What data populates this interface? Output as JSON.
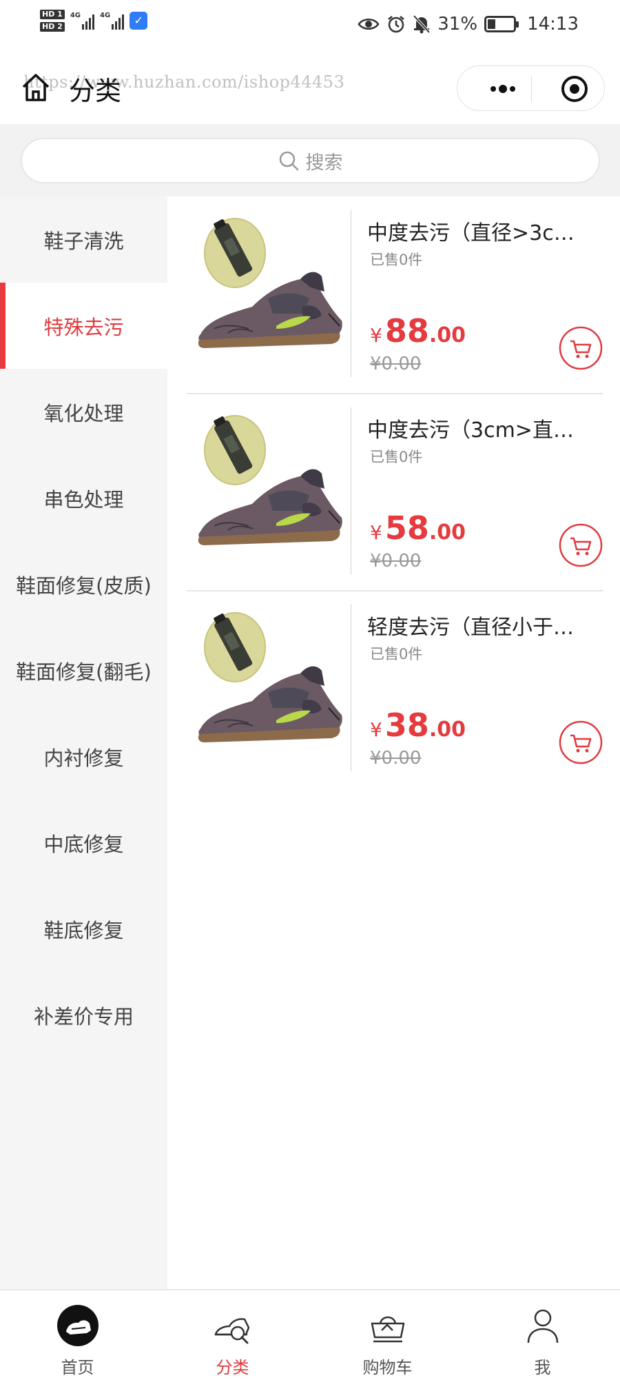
{
  "status_bar": {
    "hd1": "HD 1",
    "hd2": "HD 2",
    "net1": "4G",
    "net2": "4G",
    "battery_percent": "31%",
    "battery_level": 0.31,
    "time": "14:13",
    "icons": [
      "eye-icon",
      "alarm-icon",
      "mute-bell-icon",
      "battery-icon"
    ]
  },
  "nav": {
    "title": "分类",
    "watermark": "https://www.huzhan.com/ishop44453"
  },
  "search": {
    "placeholder": "搜索"
  },
  "sidebar": {
    "items": [
      {
        "label": "鞋子清洗"
      },
      {
        "label": "特殊去污"
      },
      {
        "label": "氧化处理"
      },
      {
        "label": "串色处理"
      },
      {
        "label": "鞋面修复(皮质)"
      },
      {
        "label": "鞋面修复(翻毛)"
      },
      {
        "label": "内衬修复"
      },
      {
        "label": "中底修复"
      },
      {
        "label": "鞋底修复"
      },
      {
        "label": "补差价专用"
      }
    ],
    "active_index": 1
  },
  "products": [
    {
      "name": "中度去污（直径>3c…",
      "sold": "已售0件",
      "currency": "¥",
      "price_int": "88",
      "price_dec": ".00",
      "original": "¥0.00"
    },
    {
      "name": "中度去污（3cm>直…",
      "sold": "已售0件",
      "currency": "¥",
      "price_int": "58",
      "price_dec": ".00",
      "original": "¥0.00"
    },
    {
      "name": "轻度去污（直径小于…",
      "sold": "已售0件",
      "currency": "¥",
      "price_int": "38",
      "price_dec": ".00",
      "original": "¥0.00"
    }
  ],
  "tabbar": {
    "items": [
      {
        "label": "首页",
        "icon": "home-icon"
      },
      {
        "label": "分类",
        "icon": "category-icon"
      },
      {
        "label": "购物车",
        "icon": "cart-icon"
      },
      {
        "label": "我",
        "icon": "user-icon"
      }
    ],
    "active_index": 1
  },
  "colors": {
    "accent": "#e0393e",
    "sidebar_bg": "#f5f5f5",
    "search_bg": "#f2f2f2"
  }
}
